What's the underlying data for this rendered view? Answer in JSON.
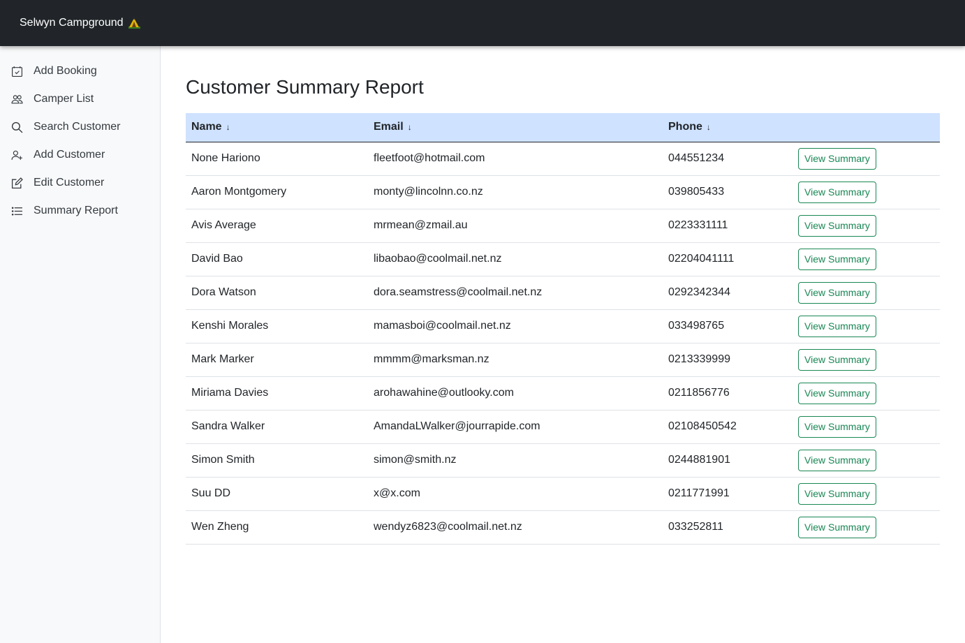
{
  "app": {
    "title": "Selwyn Campground"
  },
  "sidebar": {
    "items": [
      {
        "label": "Add Booking",
        "icon": "calendar-check-icon"
      },
      {
        "label": "Camper List",
        "icon": "people-icon"
      },
      {
        "label": "Search Customer",
        "icon": "search-icon"
      },
      {
        "label": "Add Customer",
        "icon": "person-add-icon"
      },
      {
        "label": "Edit Customer",
        "icon": "pencil-square-icon"
      },
      {
        "label": "Summary Report",
        "icon": "list-icon"
      }
    ]
  },
  "main": {
    "title": "Customer Summary Report",
    "table": {
      "columns": [
        "Name",
        "Email",
        "Phone"
      ],
      "action_label": "View Summary",
      "rows": [
        {
          "name": "None Hariono",
          "email": "fleetfoot@hotmail.com",
          "phone": "044551234"
        },
        {
          "name": "Aaron Montgomery",
          "email": "monty@lincolnn.co.nz",
          "phone": "039805433"
        },
        {
          "name": "Avis Average",
          "email": "mrmean@zmail.au",
          "phone": "0223331111"
        },
        {
          "name": "David Bao",
          "email": "libaobao@coolmail.net.nz",
          "phone": "02204041111"
        },
        {
          "name": "Dora Watson",
          "email": "dora.seamstress@coolmail.net.nz",
          "phone": "0292342344"
        },
        {
          "name": "Kenshi Morales",
          "email": "mamasboi@coolmail.net.nz",
          "phone": "033498765"
        },
        {
          "name": "Mark Marker",
          "email": "mmmm@marksman.nz",
          "phone": "0213339999"
        },
        {
          "name": "Miriama Davies",
          "email": "arohawahine@outlooky.com",
          "phone": "0211856776"
        },
        {
          "name": "Sandra Walker",
          "email": "AmandaLWalker@jourrapide.com",
          "phone": "02108450542"
        },
        {
          "name": "Simon Smith",
          "email": "simon@smith.nz",
          "phone": "0244881901"
        },
        {
          "name": "Suu DD",
          "email": "x@x.com",
          "phone": "0211771991"
        },
        {
          "name": "Wen Zheng",
          "email": "wendyz6823@coolmail.net.nz",
          "phone": "033252811"
        }
      ]
    }
  },
  "colors": {
    "topbar": "#212529",
    "sidebar": "#f8f9fa",
    "table_header": "#cfe2ff",
    "button_accent": "#198754"
  }
}
